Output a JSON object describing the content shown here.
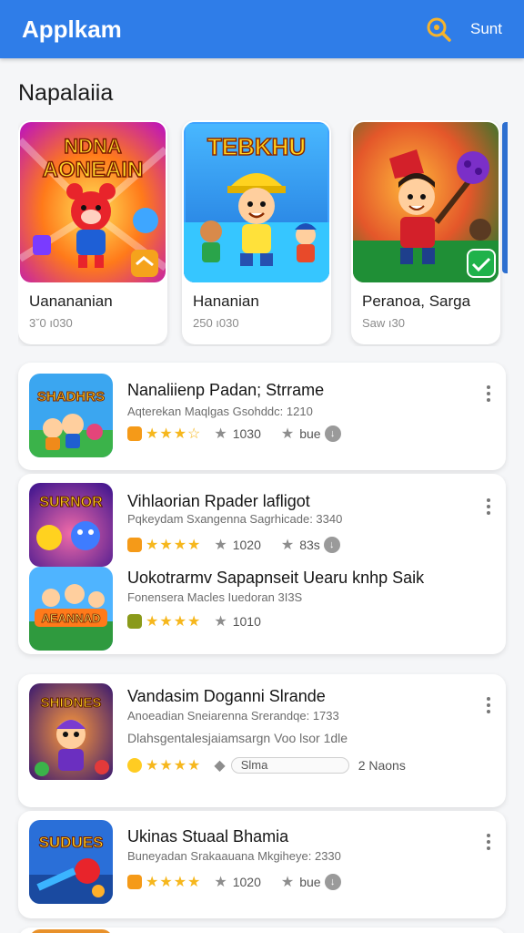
{
  "appbar": {
    "title": "Applkam",
    "action": "Sunt",
    "search_icon": "search-icon"
  },
  "section": {
    "title": "Napalaiia"
  },
  "featured": [
    {
      "name": "Uanananian",
      "meta": "3ˇ0 ı030",
      "art_text": "NDNA AONEAIN"
    },
    {
      "name": "Hananian",
      "meta": "250 ı030",
      "art_text": "TEBKHU"
    },
    {
      "name": "Peranoa, Sarga",
      "meta": "Saw ı30",
      "art_text": ""
    }
  ],
  "list": [
    {
      "title": "Nanaliienp Padan; Strrame",
      "sub": "Aqterekan Maqlgas Gsohddc: 1210",
      "rating_count": "1030",
      "tag": "bue",
      "art_text": "SHADHRS"
    },
    {
      "title": "Vihlaorian Rpader lafligot",
      "sub": "Pqkeydam Sxangenna Sagrhicade: 3340",
      "rating_count": "1020",
      "tag": "83s",
      "art_text": "SURNOR"
    },
    {
      "title": "Uokotrarmv Sapapnseit Uearu knhp Saik",
      "sub": "Fonensera Macles Iuedoran 3I3S",
      "rating_count": "1010",
      "tag": "",
      "art_text": "AEANNAD"
    },
    {
      "title": "Vandasim Doganni Slrande",
      "sub": "Anoeadian Sneiarenna Srerandqe: 1733",
      "sub2": "Dlahsgentalesjaiamsargn Voo lsor 1dle",
      "progress_label": "Slma",
      "installs": "2 Naons",
      "art_text": "SHIDNES"
    },
    {
      "title": "Ukinas Stuaal Bhamia",
      "sub": "Buneyadan Srakaauana Mkgiheye: 2330",
      "rating_count": "1020",
      "tag": "bue",
      "art_text": "SUDUES"
    }
  ],
  "colors": {
    "primary": "#2f7de8",
    "star": "#f6b71d",
    "background": "#f5f6f8"
  }
}
